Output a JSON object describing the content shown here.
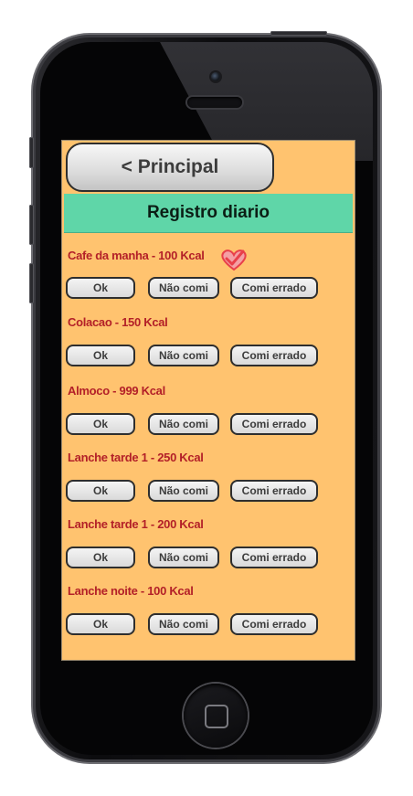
{
  "nav": {
    "back_label": "< Principal"
  },
  "header": {
    "title": "Registro diario"
  },
  "meals": [
    {
      "label": "Cafe da manha - 100 Kcal",
      "checked": true
    },
    {
      "label": "Colacao - 150 Kcal",
      "checked": false
    },
    {
      "label": "Almoco - 999 Kcal",
      "checked": false
    },
    {
      "label": "Lanche tarde 1 - 250 Kcal",
      "checked": false
    },
    {
      "label": "Lanche tarde 1 - 200 Kcal",
      "checked": false
    },
    {
      "label": "Lanche noite - 100 Kcal",
      "checked": false
    }
  ],
  "actions": {
    "ok_label": "Ok",
    "nao_comi_label": "Não comi",
    "comi_errado_label": "Comi errado"
  },
  "colors": {
    "screen_bg": "#ffc36f",
    "header_bg": "#5fd6a8",
    "meal_text": "#b32028",
    "check": "#e8404a"
  },
  "icons": {
    "check": "heart-check-icon",
    "home": "home-button-icon"
  }
}
